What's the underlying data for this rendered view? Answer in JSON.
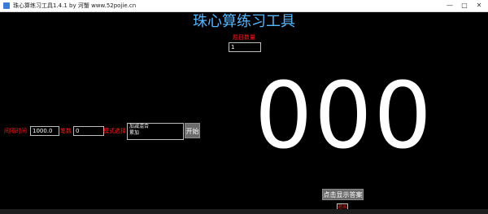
{
  "window": {
    "title": "珠心算练习工具1.4.1 by 河蟹 www.52pojie.cn",
    "icons": {
      "app": "app-icon",
      "minimize": "minimize-icon",
      "maximize": "maximize-icon",
      "close": "close-icon"
    },
    "controls": {
      "minimize": "—",
      "maximize": "□",
      "close": "✕"
    }
  },
  "header": {
    "title": "珠心算练习工具",
    "count_label": "题目数量",
    "count_value": "1"
  },
  "display": {
    "number": "000"
  },
  "settings": {
    "interval_label": "间隔时间",
    "interval_value": "1000.0",
    "strokes_label": "笔数",
    "strokes_value": "0",
    "mode_label": "模式选择",
    "mode_options": [
      "加减混合",
      "累加"
    ],
    "start_label": "开始"
  },
  "footer": {
    "answer_label": "点击显示答案",
    "exit_label": "退出"
  },
  "colors": {
    "background": "#000000",
    "title": "#57b6ff",
    "label": "#ff1d1d",
    "number": "#ffffff",
    "button": "#6b6b6b"
  }
}
